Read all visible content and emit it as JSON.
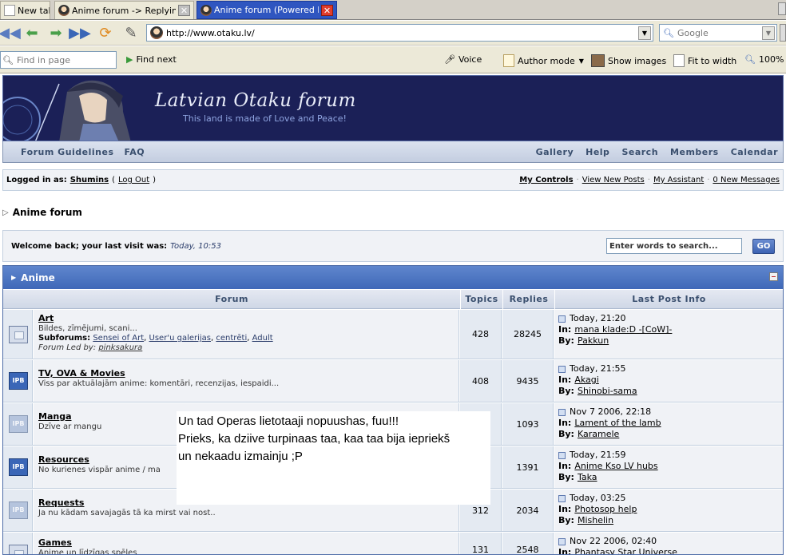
{
  "browser": {
    "tabs": [
      {
        "label": "New tab",
        "active": false
      },
      {
        "label": "Anime forum -> Replying...",
        "active": false
      },
      {
        "label": "Anime forum (Powered b...",
        "active": true
      }
    ],
    "url": "http://www.otaku.lv/",
    "search_placeholder": "Google",
    "find_placeholder": "Find in page",
    "find_next": "Find next",
    "voice": "Voice",
    "author_mode": "Author mode",
    "show_images": "Show images",
    "fit_to_width": "Fit to width",
    "zoom": "100%"
  },
  "forum": {
    "banner_title": "Latvian Otaku forum",
    "banner_tagline": "This land is made of Love and Peace!",
    "menu_left": [
      "Forum Guidelines",
      "FAQ"
    ],
    "menu_right": [
      "Gallery",
      "Help",
      "Search",
      "Members",
      "Calendar"
    ],
    "logged_in_label": "Logged in as:",
    "username": "Shumins",
    "logout": "Log Out",
    "user_links": [
      "My Controls",
      "View New Posts",
      "My Assistant",
      "0 New Messages"
    ],
    "breadcrumb": "Anime forum",
    "welcome_text": "Welcome back; your last visit was:",
    "last_visit": "Today, 10:53",
    "search_placeholder": "Enter words to search...",
    "go_label": "GO",
    "category": "Anime",
    "columns": {
      "forum": "Forum",
      "topics": "Topics",
      "replies": "Replies",
      "last_post": "Last Post Info"
    },
    "rows": [
      {
        "title": "Art",
        "desc": "Bildes, zīmējumi, scani...",
        "subforums_label": "Subforums:",
        "subforums": [
          "Sensei of Art",
          "User'u galerijas",
          "centrēti",
          "Adult"
        ],
        "led_label": "Forum Led by:",
        "led_by": "pinksakura",
        "topics": "428",
        "replies": "28245",
        "last_time": "Today, 21:20",
        "last_in": "mana klade:D -[CoW]-",
        "last_by": "Pakkun",
        "icon": "blank"
      },
      {
        "title": "TV, OVA & Movies",
        "desc": "Viss par aktuālajām anime: komentāri, recenzijas, iespaidi...",
        "topics": "408",
        "replies": "9435",
        "last_time": "Today, 21:55",
        "last_in": "Akagi",
        "last_by": "Shinobi-sama",
        "icon": "new"
      },
      {
        "title": "Manga",
        "desc": "Dzīve ar mangu",
        "topics": "",
        "replies": "1093",
        "last_time": "Nov 7 2006, 22:18",
        "last_in": "Lament of the lamb",
        "last_by": "Karamele",
        "icon": "old"
      },
      {
        "title": "Resources",
        "desc": "No kurienes vispār anime / ma",
        "topics": "",
        "replies": "1391",
        "last_time": "Today, 21:59",
        "last_in": "Anime Kso LV hubs",
        "last_by": "Taka",
        "icon": "new"
      },
      {
        "title": "Requests",
        "desc": "Ja nu kādam savajagās tā ka mirst vai nost..",
        "topics": "312",
        "replies": "2034",
        "last_time": "Today, 03:25",
        "last_in": "Photosop help",
        "last_by": "Mishelin",
        "icon": "old"
      },
      {
        "title": "Games",
        "desc": "Anime un līdzīgas spēles",
        "topics": "131",
        "replies": "2548",
        "last_time": "Nov 22 2006, 02:40",
        "last_in": "Phantasy Star Universe",
        "last_by": "",
        "icon": "blank"
      }
    ],
    "in_label": "In:",
    "by_label": "By:"
  },
  "overlay": {
    "lines": [
      "Un tad Operas lietotaaji nopuushas, fuu!!!",
      "Prieks, ka dziive turpinaas taa, kaa taa bija iepriekš",
      "un nekaadu izmainju ;P"
    ]
  },
  "colors": {
    "banner_bg": "#1b2057",
    "category_bar": "#3f68b8",
    "row_bg": "#f0f2f6"
  }
}
